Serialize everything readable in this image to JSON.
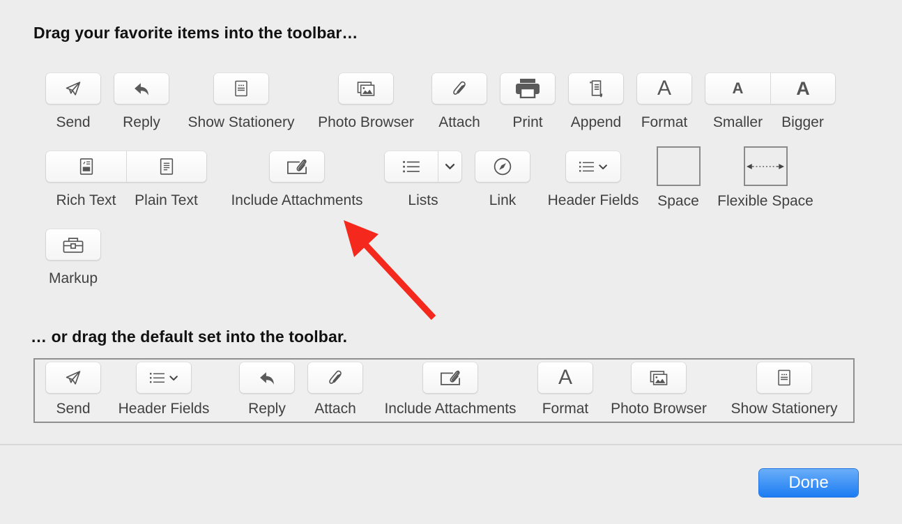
{
  "headings": {
    "favorites": "Drag your favorite items into the toolbar…",
    "default_set": "… or drag the default set into the toolbar."
  },
  "favorites": {
    "send": {
      "label": "Send",
      "icon": "paper-plane-icon"
    },
    "reply": {
      "label": "Reply",
      "icon": "reply-arrow-icon"
    },
    "show_stationery": {
      "label": "Show Stationery",
      "icon": "stationery-icon"
    },
    "photo_browser": {
      "label": "Photo Browser",
      "icon": "photos-icon"
    },
    "attach": {
      "label": "Attach",
      "icon": "paperclip-icon"
    },
    "print": {
      "label": "Print",
      "icon": "printer-icon"
    },
    "append": {
      "label": "Append",
      "icon": "append-icon"
    },
    "format": {
      "label": "Format",
      "icon": "format-a-icon",
      "glyph": "A"
    },
    "smaller": {
      "label": "Smaller",
      "icon": "smaller-font-icon",
      "glyph": "A"
    },
    "bigger": {
      "label": "Bigger",
      "icon": "bigger-font-icon",
      "glyph": "A"
    },
    "rich_text": {
      "label": "Rich Text",
      "icon": "rich-text-doc-icon"
    },
    "plain_text": {
      "label": "Plain Text",
      "icon": "plain-text-doc-icon"
    },
    "include_attachments": {
      "label": "Include Attachments",
      "icon": "include-attachment-icon"
    },
    "lists": {
      "label": "Lists",
      "icon": "bullet-list-icon"
    },
    "link": {
      "label": "Link",
      "icon": "compass-icon"
    },
    "header_fields": {
      "label": "Header Fields",
      "icon": "header-fields-icon"
    },
    "space": {
      "label": "Space"
    },
    "flexible_space": {
      "label": "Flexible Space",
      "icon": "double-arrow-icon"
    },
    "markup": {
      "label": "Markup",
      "icon": "toolbox-icon"
    }
  },
  "default_set": [
    {
      "label": "Send"
    },
    {
      "label": "Header Fields"
    },
    {
      "label": "Reply"
    },
    {
      "label": "Attach"
    },
    {
      "label": "Include Attachments"
    },
    {
      "label": "Format",
      "glyph": "A"
    },
    {
      "label": "Photo Browser"
    },
    {
      "label": "Show Stationery"
    }
  ],
  "footer": {
    "done_label": "Done"
  },
  "colors": {
    "accent": "#1b7cf2",
    "annotation_arrow": "#f5281e",
    "icon": "#555555"
  }
}
